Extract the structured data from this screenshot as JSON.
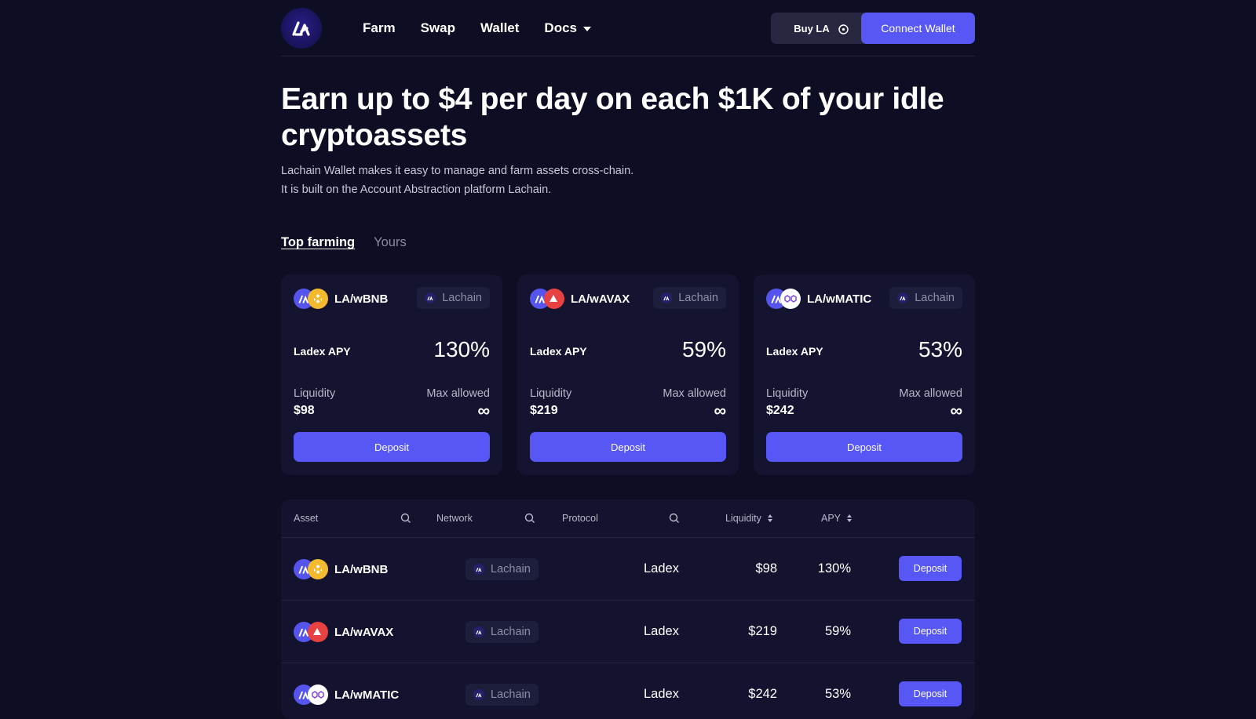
{
  "nav": {
    "links": [
      "Farm",
      "Swap",
      "Wallet",
      "Docs"
    ],
    "buy_label": "Buy LA",
    "connect_label": "Connect Wallet"
  },
  "hero": {
    "title": "Earn up to $4 per day on each $1K of your idle cryptoassets",
    "line1": "Lachain Wallet makes it easy to manage and farm assets cross-chain.",
    "line2": "It is built on the Account Abstraction platform Lachain."
  },
  "tabs": {
    "active": "Top farming",
    "other": "Yours"
  },
  "cards": [
    {
      "pair": "LA/wBNB",
      "network": "Lachain",
      "apy_label": "Ladex APY",
      "apy": "130%",
      "liq_label": "Liquidity",
      "liquidity": "$98",
      "max_label": "Max allowed",
      "max": "∞",
      "button": "Deposit"
    },
    {
      "pair": "LA/wAVAX",
      "network": "Lachain",
      "apy_label": "Ladex APY",
      "apy": "59%",
      "liq_label": "Liquidity",
      "liquidity": "$219",
      "max_label": "Max allowed",
      "max": "∞",
      "button": "Deposit"
    },
    {
      "pair": "LA/wMATIC",
      "network": "Lachain",
      "apy_label": "Ladex APY",
      "apy": "53%",
      "liq_label": "Liquidity",
      "liquidity": "$242",
      "max_label": "Max allowed",
      "max": "∞",
      "button": "Deposit"
    }
  ],
  "table": {
    "headers": {
      "asset": "Asset",
      "network": "Network",
      "protocol": "Protocol",
      "liquidity": "Liquidity",
      "apy": "APY"
    },
    "rows": [
      {
        "asset": "LA/wBNB",
        "network": "Lachain",
        "protocol": "Ladex",
        "liquidity": "$98",
        "apy": "130%",
        "button": "Deposit"
      },
      {
        "asset": "LA/wAVAX",
        "network": "Lachain",
        "protocol": "Ladex",
        "liquidity": "$219",
        "apy": "59%",
        "button": "Deposit"
      },
      {
        "asset": "LA/wMATIC",
        "network": "Lachain",
        "protocol": "Ladex",
        "liquidity": "$242",
        "apy": "53%",
        "button": "Deposit"
      }
    ]
  },
  "colors": {
    "bg": "#0d0d24",
    "card": "#141431",
    "accent": "#5657f5",
    "bnb": "#f3ba2f",
    "avax": "#e84142",
    "matic": "#8247e5"
  }
}
